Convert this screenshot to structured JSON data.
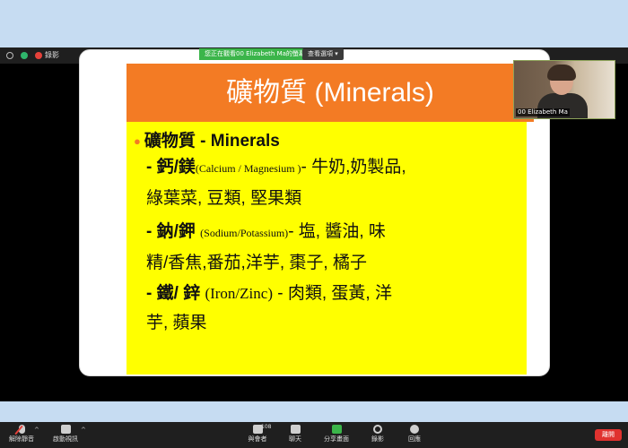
{
  "topbar": {
    "recording_label": "錄影",
    "share_banner": "您正在觀看00 Elizabeth Ma的螢幕",
    "view_options": "查看選項 ▾"
  },
  "slide": {
    "title": "礦物質 (Minerals)",
    "bullet": "礦物質 - Minerals",
    "entries": [
      {
        "lead": "- 鈣/鎂",
        "latin": "(Calcium / Magnesium )",
        "line1_rest": "- 牛奶,奶製品,",
        "line2": "綠葉菜, 豆類, 堅果類"
      },
      {
        "lead": "- 鈉/鉀",
        "latin": "(Sodium/Potassium)",
        "line1_rest": "- 塩, 醬油, 味",
        "line2": "精/香焦,番茄,洋芋, 棗子, 橘子"
      },
      {
        "lead": "- 鐵/ 鋅",
        "latin": "(Iron/Zinc)",
        "line1_rest": "- 肉類, 蛋黃, 洋",
        "line2": "芋, 蘋果"
      }
    ]
  },
  "video": {
    "participant_name": "00 Elizabeth Ma"
  },
  "toolbar": {
    "mute_label": "解除靜音",
    "video_label": "啟動視訊",
    "participants_label": "與會者",
    "participants_count": "108",
    "chat_label": "聊天",
    "share_label": "分享畫面",
    "record_label": "錄影",
    "reactions_label": "回應",
    "leave_label": "離開"
  },
  "colors": {
    "slide_header": "#f37b24",
    "slide_body": "#ffff00",
    "share_banner": "#3bb54a",
    "leave_button": "#e0322f"
  }
}
